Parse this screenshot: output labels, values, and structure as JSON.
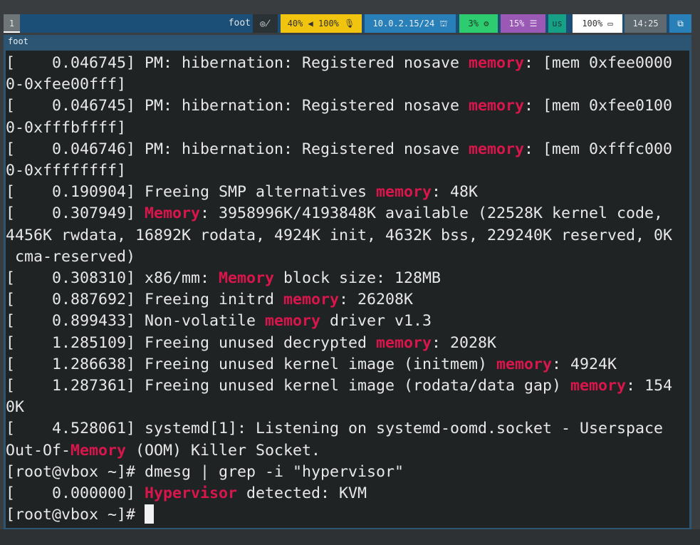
{
  "topbar": {
    "workspace": "1",
    "window_title": "foot",
    "modules": [
      {
        "name": "idle-inhibitor",
        "text": "",
        "icon": "eye-off-icon",
        "bg": "#2a3236",
        "fg": "#e0e0e0"
      },
      {
        "name": "audio",
        "text": "40% ◀ 100% 🎙",
        "icon": "speaker-mic-icon",
        "bg": "#f1c40f",
        "fg": "#333333"
      },
      {
        "name": "network",
        "text": "10.0.2.15/24 ⛫",
        "icon": "ethernet-icon",
        "bg": "#2980b9",
        "fg": "#e8eef4"
      },
      {
        "name": "cpu",
        "text": "3% ⚙",
        "icon": "cpu-icon",
        "bg": "#2ecc71",
        "fg": "#1b3a22"
      },
      {
        "name": "memory",
        "text": "15% ☰",
        "icon": "memory-icon",
        "bg": "#9b59b6",
        "fg": "#f0e6f6"
      },
      {
        "name": "keyboard-layout",
        "text": "us",
        "icon": "",
        "bg": "#16a085",
        "fg": "#1c3c36"
      },
      {
        "name": "battery",
        "text": "100% ▭",
        "icon": "battery-icon",
        "bg": "#ffffff",
        "fg": "#333333"
      },
      {
        "name": "clock",
        "text": "14:25",
        "icon": "",
        "bg": "#5f6a70",
        "fg": "#e6e6e6"
      },
      {
        "name": "tray",
        "text": "⧉",
        "icon": "windows-icon",
        "bg": "#2980b9",
        "fg": "#ffffff"
      }
    ]
  },
  "window": {
    "title": "foot"
  },
  "colors": {
    "highlight": "#d8164c",
    "terminal_bg": "#1f2324",
    "text": "#e8e8e8"
  },
  "terminal": {
    "lines": [
      [
        [
          "[    0.046745] PM: hibernation: Registered nosave ",
          0
        ],
        [
          "memory",
          1
        ],
        [
          ": [mem 0xfee0000",
          0
        ]
      ],
      [
        [
          "0-0xfee00fff]",
          0
        ]
      ],
      [
        [
          "[    0.046745] PM: hibernation: Registered nosave ",
          0
        ],
        [
          "memory",
          1
        ],
        [
          ": [mem 0xfee0100",
          0
        ]
      ],
      [
        [
          "0-0xfffbffff]",
          0
        ]
      ],
      [
        [
          "[    0.046746] PM: hibernation: Registered nosave ",
          0
        ],
        [
          "memory",
          1
        ],
        [
          ": [mem 0xfffc000",
          0
        ]
      ],
      [
        [
          "0-0xffffffff]",
          0
        ]
      ],
      [
        [
          "[    0.190904] Freeing SMP alternatives ",
          0
        ],
        [
          "memory",
          1
        ],
        [
          ": 48K",
          0
        ]
      ],
      [
        [
          "[    0.307949] ",
          0
        ],
        [
          "Memory",
          1
        ],
        [
          ": 3958996K/4193848K available (22528K kernel code,",
          0
        ]
      ],
      [
        [
          "4456K rwdata, 16892K rodata, 4924K init, 4632K bss, 229240K reserved, 0K",
          0
        ]
      ],
      [
        [
          " cma-reserved)",
          0
        ]
      ],
      [
        [
          "[    0.308310] x86/mm: ",
          0
        ],
        [
          "Memory",
          1
        ],
        [
          " block size: 128MB",
          0
        ]
      ],
      [
        [
          "[    0.887692] Freeing initrd ",
          0
        ],
        [
          "memory",
          1
        ],
        [
          ": 26208K",
          0
        ]
      ],
      [
        [
          "[    0.899433] Non-volatile ",
          0
        ],
        [
          "memory",
          1
        ],
        [
          " driver v1.3",
          0
        ]
      ],
      [
        [
          "[    1.285109] Freeing unused decrypted ",
          0
        ],
        [
          "memory",
          1
        ],
        [
          ": 2028K",
          0
        ]
      ],
      [
        [
          "[    1.286638] Freeing unused kernel image (initmem) ",
          0
        ],
        [
          "memory",
          1
        ],
        [
          ": 4924K",
          0
        ]
      ],
      [
        [
          "[    1.287361] Freeing unused kernel image (rodata/data gap) ",
          0
        ],
        [
          "memory",
          1
        ],
        [
          ": 154",
          0
        ]
      ],
      [
        [
          "0K",
          0
        ]
      ],
      [
        [
          "[    4.528061] systemd[1]: Listening on systemd-oomd.socket - Userspace",
          0
        ]
      ],
      [
        [
          "Out-Of-",
          0
        ],
        [
          "Memory",
          1
        ],
        [
          " (OOM) Killer Socket.",
          0
        ]
      ],
      [
        [
          "[root@vbox ~]# dmesg | grep -i \"hypervisor\"",
          0
        ]
      ],
      [
        [
          "[    0.000000] ",
          0
        ],
        [
          "Hypervisor",
          1
        ],
        [
          " detected: KVM",
          0
        ]
      ],
      [
        [
          "[root@vbox ~]# ",
          0
        ]
      ]
    ]
  }
}
